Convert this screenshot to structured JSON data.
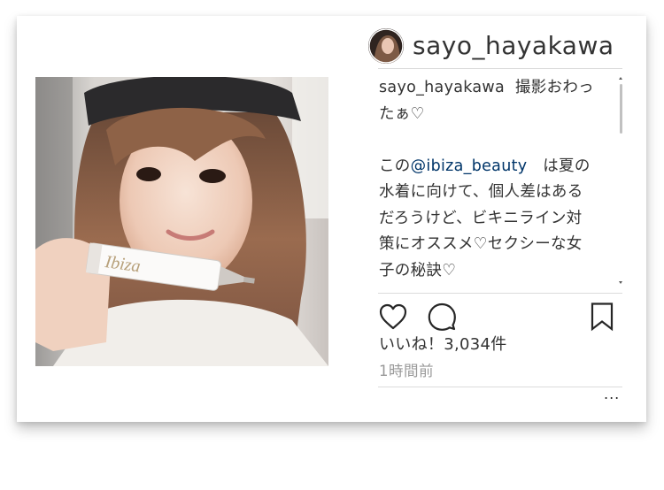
{
  "post": {
    "username": "sayo_hayakawa",
    "caption": {
      "author": "sayo_hayakawa",
      "line1_text": "撮影おわっ",
      "line2": "たぁ♡",
      "line3_prefix": "この",
      "mention": "@ibiza_beauty",
      "line3_suffix": "　は夏の",
      "line4": "水着に向けて、個人差はある",
      "line5": "だろうけど、ビキニライン対",
      "line6": "策にオススメ♡セクシーな女",
      "line7": "子の秘訣♡"
    },
    "likes": "いいね！3,034件",
    "time": "1時間前",
    "more": "..."
  },
  "photo": {
    "product_label": "Ibiza"
  },
  "icons": {
    "avatar": "avatar",
    "like": "heart-icon",
    "comment": "comment-icon",
    "save": "bookmark-icon",
    "more": "more-options-icon"
  },
  "colors": {
    "mention": "#003569",
    "text": "#333333",
    "muted": "#999999",
    "divider": "#dbdbdb"
  }
}
